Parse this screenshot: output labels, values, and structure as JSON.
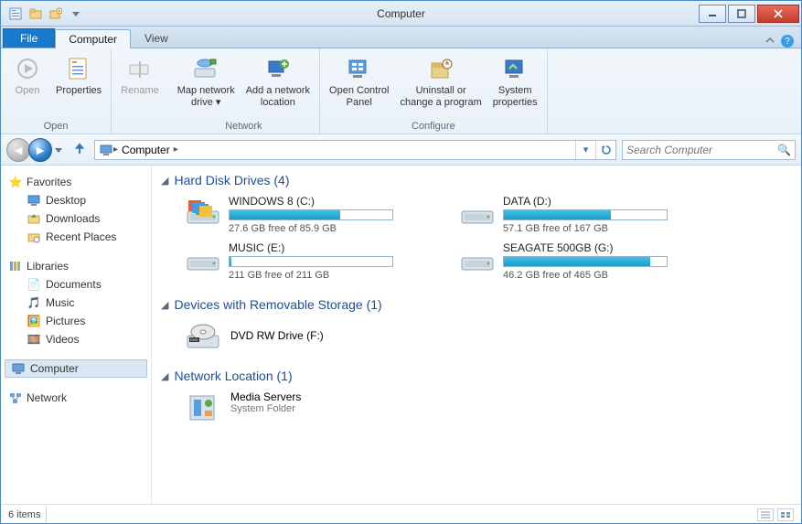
{
  "window": {
    "title": "Computer"
  },
  "tabs": {
    "file": "File",
    "computer": "Computer",
    "view": "View"
  },
  "ribbon": {
    "open_group": "Open",
    "open": "Open",
    "properties": "Properties",
    "rename": "Rename",
    "network_group": "Network",
    "map_drive": "Map network\ndrive ▾",
    "add_loc": "Add a network\nlocation",
    "configure_group": "Configure",
    "control_panel": "Open Control\nPanel",
    "uninstall": "Uninstall or\nchange a program",
    "sys_props": "System\nproperties"
  },
  "nav": {
    "breadcrumb_root": "Computer",
    "search_placeholder": "Search Computer"
  },
  "sidebar": {
    "favorites": "Favorites",
    "fav_items": [
      "Desktop",
      "Downloads",
      "Recent Places"
    ],
    "favorites_desktop": "Desktop",
    "favorites_downloads": "Downloads",
    "favorites_recent": "Recent Places",
    "libraries": "Libraries",
    "lib_items": [
      "Documents",
      "Music",
      "Pictures",
      "Videos"
    ],
    "lib_documents": "Documents",
    "lib_music": "Music",
    "lib_pictures": "Pictures",
    "lib_videos": "Videos",
    "computer": "Computer",
    "network": "Network"
  },
  "sections": {
    "hdd": "Hard Disk Drives (4)",
    "removable": "Devices with Removable Storage (1)",
    "netloc": "Network Location (1)"
  },
  "drives": [
    {
      "name": "WINDOWS 8 (C:)",
      "free": "27.6 GB free of 85.9 GB",
      "used_pct": 68
    },
    {
      "name": "DATA (D:)",
      "free": "57.1 GB free of 167 GB",
      "used_pct": 66
    },
    {
      "name": "MUSIC (E:)",
      "free": "211 GB free of 211 GB",
      "used_pct": 1
    },
    {
      "name": "SEAGATE 500GB (G:)",
      "free": "46.2 GB free of 465 GB",
      "used_pct": 90
    }
  ],
  "dvd": {
    "label": "DVD RW Drive (F:)"
  },
  "netloc_item": {
    "name": "Media Servers",
    "sub": "System Folder"
  },
  "status": {
    "count": "6 items"
  }
}
